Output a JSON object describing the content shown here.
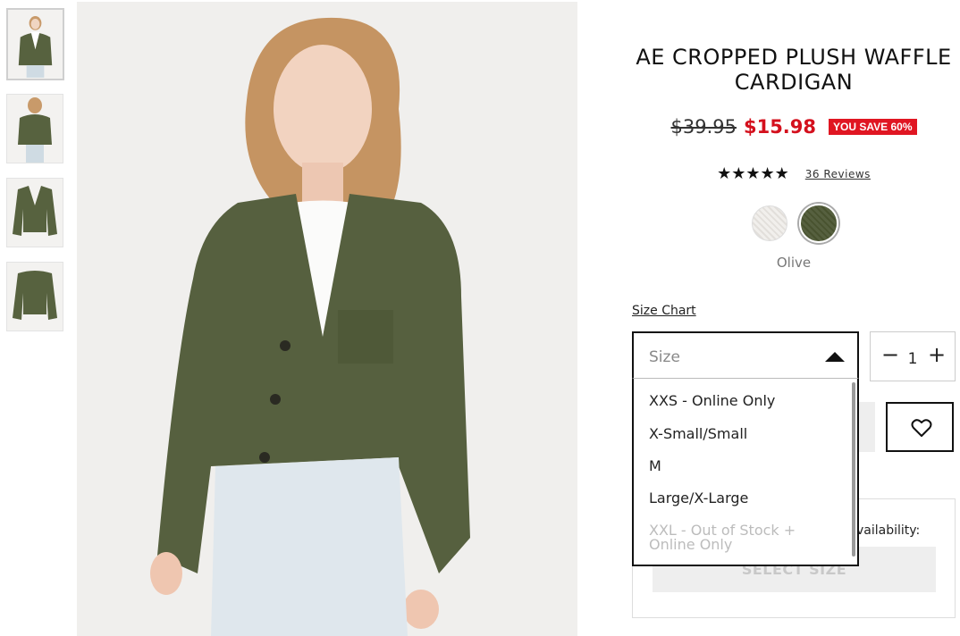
{
  "product": {
    "title": "AE CROPPED PLUSH WAFFLE CARDIGAN",
    "original_price": "$39.95",
    "sale_price": "$15.98",
    "save_badge": "YOU SAVE 60%",
    "rating_stars": "★★★★★",
    "rating_value": 5,
    "reviews_label": "36 Reviews"
  },
  "colors": {
    "swatches": [
      {
        "name": "cream",
        "hex": "#ece9e5"
      },
      {
        "name": "olive",
        "hex": "#505a38",
        "selected": true
      }
    ],
    "selected_label": "Olive"
  },
  "size": {
    "size_chart_label": "Size Chart",
    "placeholder": "Size",
    "options": [
      {
        "label": "XXS - Online Only",
        "disabled": false
      },
      {
        "label": "X-Small/Small",
        "disabled": false
      },
      {
        "label": "M",
        "disabled": false
      },
      {
        "label": "Large/X-Large",
        "disabled": false
      },
      {
        "label": "XXL - Out of Stock + Online Only",
        "disabled": true
      }
    ]
  },
  "quantity": {
    "minus": "−",
    "value": "1",
    "plus": "+"
  },
  "store": {
    "availability_label": "vailability:",
    "button_label": "SELECT SIZE"
  },
  "icons": {
    "wishlist": "heart-icon",
    "dropdown": "caret-up-icon"
  },
  "theme": {
    "sale_red": "#d4101d",
    "badge_red": "#e01622",
    "olive": "#56603f"
  }
}
